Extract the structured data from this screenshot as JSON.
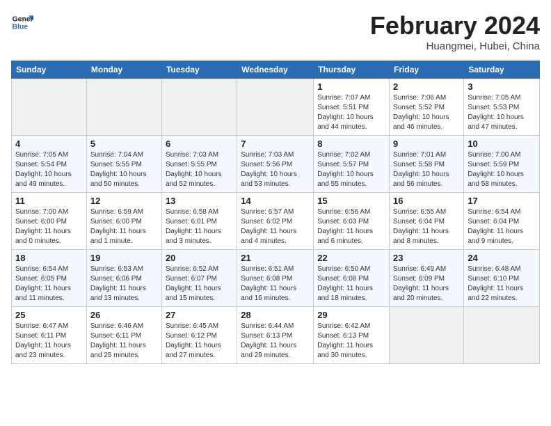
{
  "header": {
    "logo_line1": "General",
    "logo_line2": "Blue",
    "month": "February 2024",
    "location": "Huangmei, Hubei, China"
  },
  "days_of_week": [
    "Sunday",
    "Monday",
    "Tuesday",
    "Wednesday",
    "Thursday",
    "Friday",
    "Saturday"
  ],
  "weeks": [
    [
      {
        "day": "",
        "empty": true
      },
      {
        "day": "",
        "empty": true
      },
      {
        "day": "",
        "empty": true
      },
      {
        "day": "",
        "empty": true
      },
      {
        "day": "1",
        "sunrise": "7:07 AM",
        "sunset": "5:51 PM",
        "daylight": "10 hours and 44 minutes."
      },
      {
        "day": "2",
        "sunrise": "7:06 AM",
        "sunset": "5:52 PM",
        "daylight": "10 hours and 46 minutes."
      },
      {
        "day": "3",
        "sunrise": "7:05 AM",
        "sunset": "5:53 PM",
        "daylight": "10 hours and 47 minutes."
      }
    ],
    [
      {
        "day": "4",
        "sunrise": "7:05 AM",
        "sunset": "5:54 PM",
        "daylight": "10 hours and 49 minutes."
      },
      {
        "day": "5",
        "sunrise": "7:04 AM",
        "sunset": "5:55 PM",
        "daylight": "10 hours and 50 minutes."
      },
      {
        "day": "6",
        "sunrise": "7:03 AM",
        "sunset": "5:55 PM",
        "daylight": "10 hours and 52 minutes."
      },
      {
        "day": "7",
        "sunrise": "7:03 AM",
        "sunset": "5:56 PM",
        "daylight": "10 hours and 53 minutes."
      },
      {
        "day": "8",
        "sunrise": "7:02 AM",
        "sunset": "5:57 PM",
        "daylight": "10 hours and 55 minutes."
      },
      {
        "day": "9",
        "sunrise": "7:01 AM",
        "sunset": "5:58 PM",
        "daylight": "10 hours and 56 minutes."
      },
      {
        "day": "10",
        "sunrise": "7:00 AM",
        "sunset": "5:59 PM",
        "daylight": "10 hours and 58 minutes."
      }
    ],
    [
      {
        "day": "11",
        "sunrise": "7:00 AM",
        "sunset": "6:00 PM",
        "daylight": "11 hours and 0 minutes."
      },
      {
        "day": "12",
        "sunrise": "6:59 AM",
        "sunset": "6:00 PM",
        "daylight": "11 hours and 1 minute."
      },
      {
        "day": "13",
        "sunrise": "6:58 AM",
        "sunset": "6:01 PM",
        "daylight": "11 hours and 3 minutes."
      },
      {
        "day": "14",
        "sunrise": "6:57 AM",
        "sunset": "6:02 PM",
        "daylight": "11 hours and 4 minutes."
      },
      {
        "day": "15",
        "sunrise": "6:56 AM",
        "sunset": "6:03 PM",
        "daylight": "11 hours and 6 minutes."
      },
      {
        "day": "16",
        "sunrise": "6:55 AM",
        "sunset": "6:04 PM",
        "daylight": "11 hours and 8 minutes."
      },
      {
        "day": "17",
        "sunrise": "6:54 AM",
        "sunset": "6:04 PM",
        "daylight": "11 hours and 9 minutes."
      }
    ],
    [
      {
        "day": "18",
        "sunrise": "6:54 AM",
        "sunset": "6:05 PM",
        "daylight": "11 hours and 11 minutes."
      },
      {
        "day": "19",
        "sunrise": "6:53 AM",
        "sunset": "6:06 PM",
        "daylight": "11 hours and 13 minutes."
      },
      {
        "day": "20",
        "sunrise": "6:52 AM",
        "sunset": "6:07 PM",
        "daylight": "11 hours and 15 minutes."
      },
      {
        "day": "21",
        "sunrise": "6:51 AM",
        "sunset": "6:08 PM",
        "daylight": "11 hours and 16 minutes."
      },
      {
        "day": "22",
        "sunrise": "6:50 AM",
        "sunset": "6:08 PM",
        "daylight": "11 hours and 18 minutes."
      },
      {
        "day": "23",
        "sunrise": "6:49 AM",
        "sunset": "6:09 PM",
        "daylight": "11 hours and 20 minutes."
      },
      {
        "day": "24",
        "sunrise": "6:48 AM",
        "sunset": "6:10 PM",
        "daylight": "11 hours and 22 minutes."
      }
    ],
    [
      {
        "day": "25",
        "sunrise": "6:47 AM",
        "sunset": "6:11 PM",
        "daylight": "11 hours and 23 minutes."
      },
      {
        "day": "26",
        "sunrise": "6:46 AM",
        "sunset": "6:11 PM",
        "daylight": "11 hours and 25 minutes."
      },
      {
        "day": "27",
        "sunrise": "6:45 AM",
        "sunset": "6:12 PM",
        "daylight": "11 hours and 27 minutes."
      },
      {
        "day": "28",
        "sunrise": "6:44 AM",
        "sunset": "6:13 PM",
        "daylight": "11 hours and 29 minutes."
      },
      {
        "day": "29",
        "sunrise": "6:42 AM",
        "sunset": "6:13 PM",
        "daylight": "11 hours and 30 minutes."
      },
      {
        "day": "",
        "empty": true
      },
      {
        "day": "",
        "empty": true
      }
    ]
  ]
}
